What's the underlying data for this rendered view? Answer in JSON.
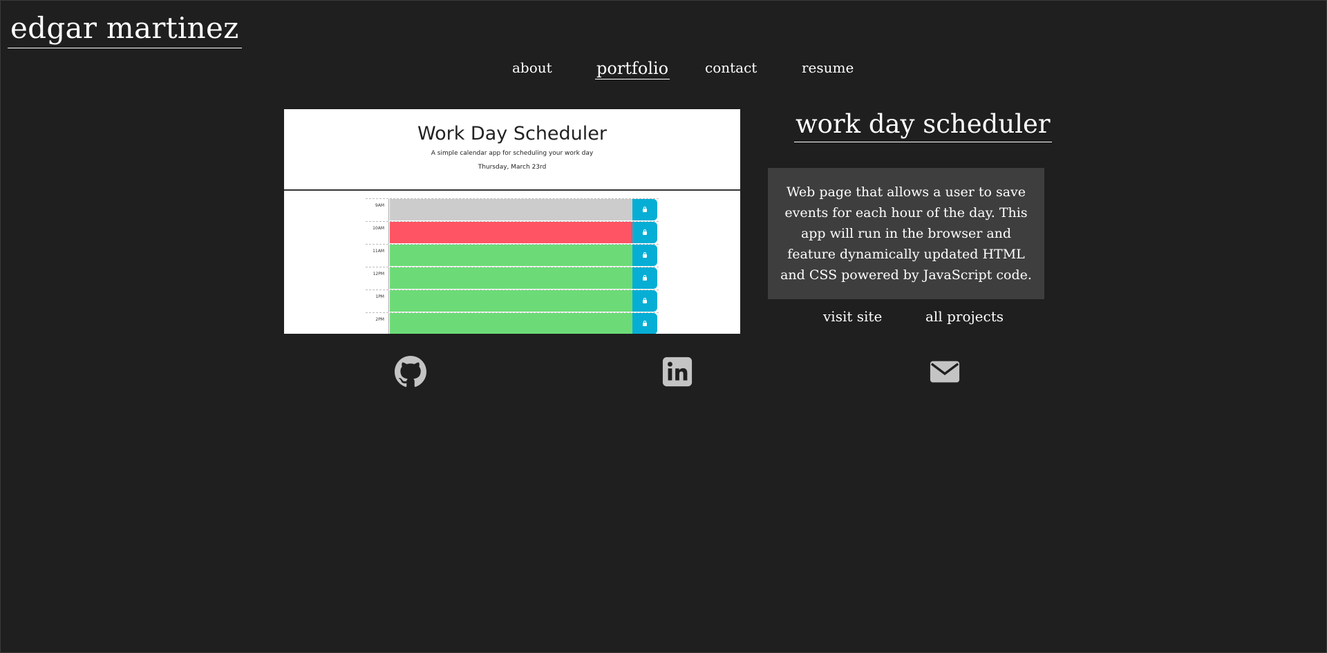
{
  "site": {
    "name": "edgar martinez"
  },
  "nav": {
    "items": [
      {
        "label": "about",
        "active": false
      },
      {
        "label": "portfolio",
        "active": true
      },
      {
        "label": "contact",
        "active": false
      },
      {
        "label": "resume",
        "active": false
      }
    ]
  },
  "preview": {
    "title": "Work Day Scheduler",
    "subtitle": "A simple calendar app for scheduling your work day",
    "date": "Thursday, March 23rd",
    "hours": [
      {
        "label": "9AM",
        "status": "past"
      },
      {
        "label": "10AM",
        "status": "present"
      },
      {
        "label": "11AM",
        "status": "future"
      },
      {
        "label": "12PM",
        "status": "future"
      },
      {
        "label": "1PM",
        "status": "future"
      },
      {
        "label": "2PM",
        "status": "future"
      }
    ],
    "colors": {
      "past": "#cccccc",
      "present": "#ff5463",
      "future": "#6cdb77",
      "save": "#06aed5"
    }
  },
  "project": {
    "title": "work day scheduler",
    "description": "Web page that allows a user to save events for each hour of the day. This app will run in the browser and feature dynamically updated HTML and CSS powered by JavaScript code.",
    "visit_label": "visit site",
    "all_label": "all projects"
  },
  "social": {
    "icons": [
      "github-icon",
      "linkedin-icon",
      "envelope-icon"
    ],
    "icon_color": "#c4c4c4"
  },
  "colors": {
    "background": "#1f1f1f",
    "card": "#3e3e3e",
    "text": "#ffffff"
  }
}
